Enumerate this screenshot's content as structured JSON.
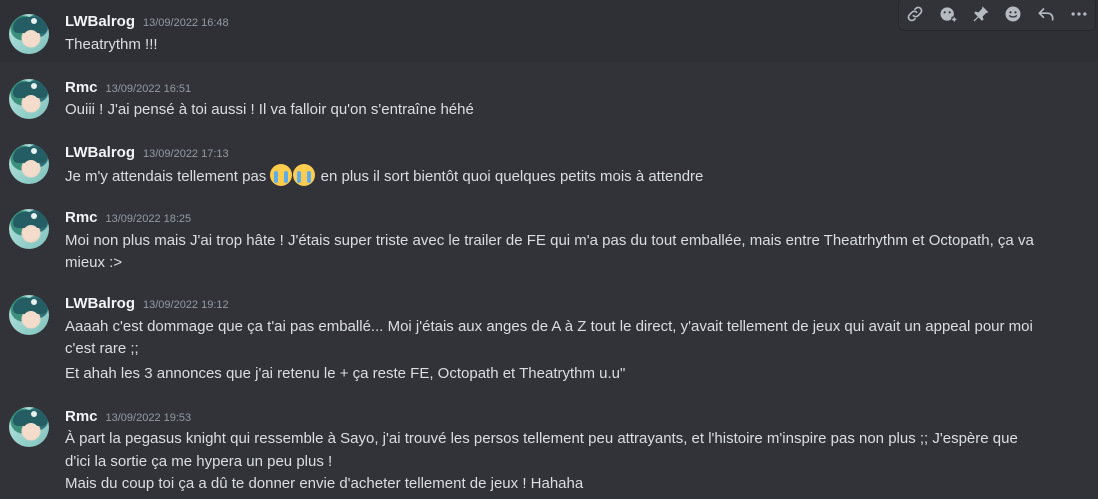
{
  "messages": [
    {
      "username": "LWBalrog",
      "timestamp": "13/09/2022 16:48",
      "lines": [
        "Theatrythm !!!"
      ]
    },
    {
      "username": "Rmc",
      "timestamp": "13/09/2022 16:51",
      "lines": [
        "Ouiii ! J'ai pensé à toi aussi ! Il va falloir qu'on s'entraîne héhé"
      ]
    },
    {
      "username": "LWBalrog",
      "timestamp": "13/09/2022 17:13",
      "lines_before_emoji": "Je m'y attendais tellement pas ",
      "emoji": [
        "sob-emoji",
        "sob-emoji"
      ],
      "lines_after_emoji": " en plus il sort bientôt quoi quelques petits mois à attendre"
    },
    {
      "username": "Rmc",
      "timestamp": "13/09/2022 18:25",
      "lines": [
        "Moi non plus mais J'ai trop hâte ! J'étais super triste avec le trailer de FE qui m'a pas du tout emballée, mais entre Theatrhythm et Octopath, ça va",
        "mieux :>"
      ]
    },
    {
      "username": "LWBalrog",
      "timestamp": "13/09/2022 19:12",
      "lines": [
        "Aaaah c'est dommage que ça t'ai pas emballé... Moi j'étais aux anges de A à Z tout le direct, y'avait tellement de jeux qui avait un appeal pour moi",
        "c'est rare ;;",
        "Et ahah les 3 annonces que j'ai retenu le + ça reste FE, Octopath et Theatrythm u.u\""
      ]
    },
    {
      "username": "Rmc",
      "timestamp": "13/09/2022 19:53",
      "lines": [
        "À part la pegasus knight qui ressemble à Sayo, j'ai trouvé les persos tellement peu attrayants, et l'histoire m'inspire pas non plus ;; J'espère que",
        "d'ici la sortie ça me hypera un peu plus !",
        "Mais du coup toi ça a dû te donner envie d'acheter tellement de jeux ! Hahaha"
      ]
    }
  ],
  "toolbar": {
    "icons": [
      "link-icon",
      "add-reaction-icon",
      "pin-icon",
      "emoji-icon",
      "reply-icon",
      "more-icon"
    ]
  }
}
